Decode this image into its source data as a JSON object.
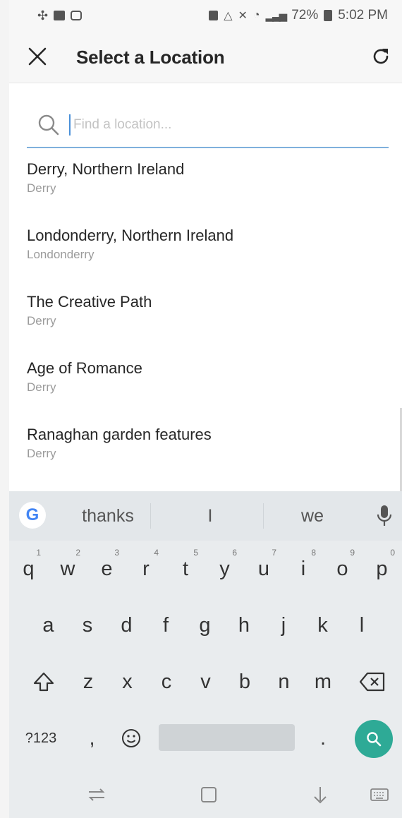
{
  "status_bar": {
    "battery": "72%",
    "time": "5:02 PM"
  },
  "header": {
    "title": "Select a Location",
    "close_icon": "close-icon",
    "refresh_icon": "refresh-icon"
  },
  "search": {
    "placeholder": "Find a location...",
    "value": ""
  },
  "results": [
    {
      "name": "Derry, Northern Ireland",
      "sub": "Derry"
    },
    {
      "name": "Londonderry, Northern Ireland",
      "sub": "Londonderry"
    },
    {
      "name": "The Creative Path",
      "sub": "Derry"
    },
    {
      "name": "Age of Romance",
      "sub": "Derry"
    },
    {
      "name": "Ranaghan garden features",
      "sub": "Derry"
    }
  ],
  "keyboard": {
    "suggestions": [
      "thanks",
      "I",
      "we"
    ],
    "row1": [
      {
        "key": "q",
        "hint": "1"
      },
      {
        "key": "w",
        "hint": "2"
      },
      {
        "key": "e",
        "hint": "3"
      },
      {
        "key": "r",
        "hint": "4"
      },
      {
        "key": "t",
        "hint": "5"
      },
      {
        "key": "y",
        "hint": "6"
      },
      {
        "key": "u",
        "hint": "7"
      },
      {
        "key": "i",
        "hint": "8"
      },
      {
        "key": "o",
        "hint": "9"
      },
      {
        "key": "p",
        "hint": "0"
      }
    ],
    "row2": [
      "a",
      "s",
      "d",
      "f",
      "g",
      "h",
      "j",
      "k",
      "l"
    ],
    "row3": [
      "z",
      "x",
      "c",
      "v",
      "b",
      "n",
      "m"
    ],
    "symbols_label": "?123",
    "comma": ",",
    "period": "."
  }
}
